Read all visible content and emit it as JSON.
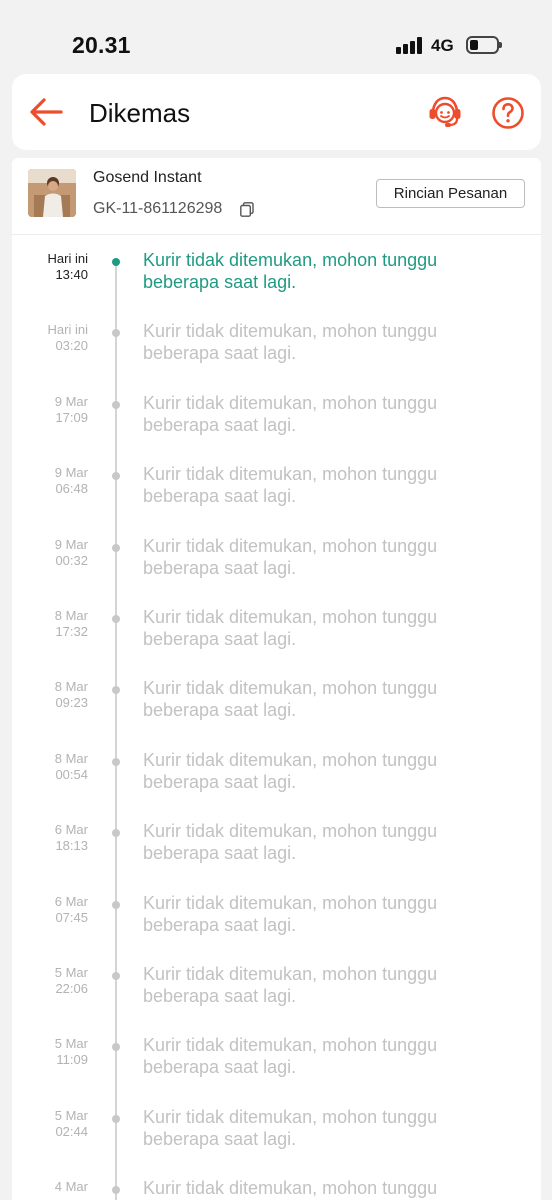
{
  "status_bar": {
    "time": "20.31",
    "network": "4G"
  },
  "header": {
    "title": "Dikemas"
  },
  "order": {
    "courier": "Gosend Instant",
    "order_id": "GK-11-861126298",
    "details_button": "Rincian Pesanan"
  },
  "colors": {
    "accent": "#ee4d2d",
    "active": "#1f9b84",
    "muted": "#c2c2c2"
  },
  "timeline": [
    {
      "date": "Hari ini",
      "time": "13:40",
      "text": "Kurir tidak ditemukan, mohon tunggu beberapa saat lagi.",
      "active": true
    },
    {
      "date": "Hari ini",
      "time": "03:20",
      "text": "Kurir tidak ditemukan, mohon tunggu beberapa saat lagi."
    },
    {
      "date": "9 Mar",
      "time": "17:09",
      "text": "Kurir tidak ditemukan, mohon tunggu beberapa saat lagi."
    },
    {
      "date": "9 Mar",
      "time": "06:48",
      "text": "Kurir tidak ditemukan, mohon tunggu beberapa saat lagi."
    },
    {
      "date": "9 Mar",
      "time": "00:32",
      "text": "Kurir tidak ditemukan, mohon tunggu beberapa saat lagi."
    },
    {
      "date": "8 Mar",
      "time": "17:32",
      "text": "Kurir tidak ditemukan, mohon tunggu beberapa saat lagi."
    },
    {
      "date": "8 Mar",
      "time": "09:23",
      "text": "Kurir tidak ditemukan, mohon tunggu beberapa saat lagi."
    },
    {
      "date": "8 Mar",
      "time": "00:54",
      "text": "Kurir tidak ditemukan, mohon tunggu beberapa saat lagi."
    },
    {
      "date": "6 Mar",
      "time": "18:13",
      "text": "Kurir tidak ditemukan, mohon tunggu beberapa saat lagi."
    },
    {
      "date": "6 Mar",
      "time": "07:45",
      "text": "Kurir tidak ditemukan, mohon tunggu beberapa saat lagi."
    },
    {
      "date": "5 Mar",
      "time": "22:06",
      "text": "Kurir tidak ditemukan, mohon tunggu beberapa saat lagi."
    },
    {
      "date": "5 Mar",
      "time": "11:09",
      "text": "Kurir tidak ditemukan, mohon tunggu beberapa saat lagi."
    },
    {
      "date": "5 Mar",
      "time": "02:44",
      "text": "Kurir tidak ditemukan, mohon tunggu beberapa saat lagi."
    },
    {
      "date": "4 Mar",
      "time": "",
      "text": "Kurir tidak ditemukan, mohon tunggu beberapa saat lagi."
    }
  ]
}
